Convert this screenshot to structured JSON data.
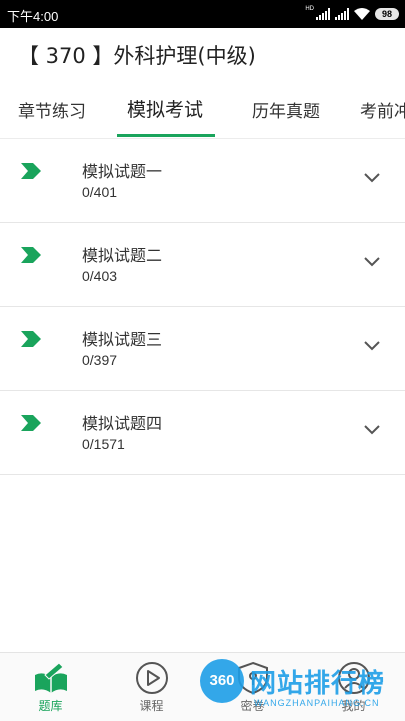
{
  "status_bar": {
    "time": "下午4:00",
    "network_label": "HD",
    "battery": "98"
  },
  "app_title": "【 370 】外科护理(中级)",
  "tabs": [
    {
      "label": "章节练习",
      "active": false
    },
    {
      "label": "模拟考试",
      "active": true
    },
    {
      "label": "历年真题",
      "active": false
    },
    {
      "label": "考前冲",
      "active": false
    }
  ],
  "items": [
    {
      "title": "模拟试题一",
      "progress": "0/401"
    },
    {
      "title": "模拟试题二",
      "progress": "0/403"
    },
    {
      "title": "模拟试题三",
      "progress": "0/397"
    },
    {
      "title": "模拟试题四",
      "progress": "0/1571"
    }
  ],
  "bottom_nav": [
    {
      "label": "题库",
      "icon": "book-pen-icon",
      "active": true
    },
    {
      "label": "课程",
      "icon": "play-circle-icon",
      "active": false
    },
    {
      "label": "密卷",
      "icon": "lock-shield-icon",
      "active": false
    },
    {
      "label": "我的",
      "icon": "person-icon",
      "active": false
    }
  ],
  "watermark": {
    "badge": "360",
    "text": "网站排行榜",
    "sub": "WANGZHANPAIHANG.CN"
  },
  "colors": {
    "accent": "#1aa45c",
    "watermark": "#1e9fe8"
  }
}
